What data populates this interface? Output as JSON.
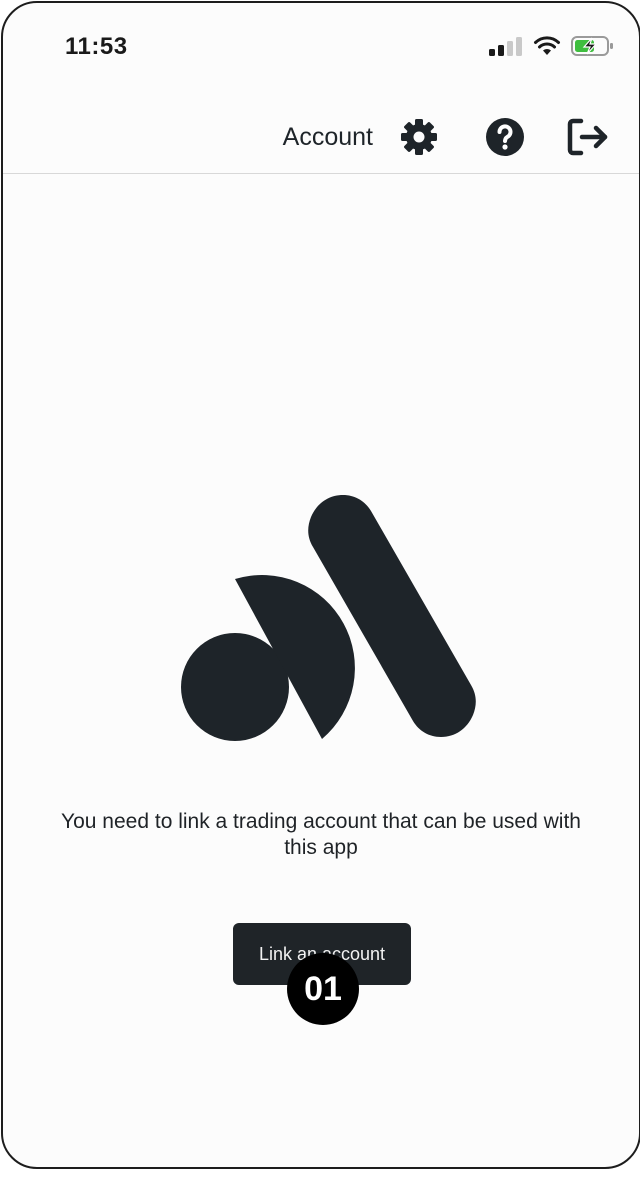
{
  "status_bar": {
    "time": "11:53",
    "signal_icon": "cellular-signal-icon",
    "wifi_icon": "wifi-icon",
    "battery_icon": "battery-charging-icon",
    "battery_color": "#3fbe3f"
  },
  "header": {
    "title": "Account",
    "settings_icon": "gear-icon",
    "help_icon": "help-icon",
    "logout_icon": "logout-icon"
  },
  "main": {
    "logo_icon": "app-logo",
    "message": "You need to link a trading account that can be used with this app",
    "link_button_label": "Link an account"
  },
  "annotation": {
    "step_label": "01"
  },
  "colors": {
    "primary_dark": "#1f2428",
    "background": "#fcfcfc"
  }
}
